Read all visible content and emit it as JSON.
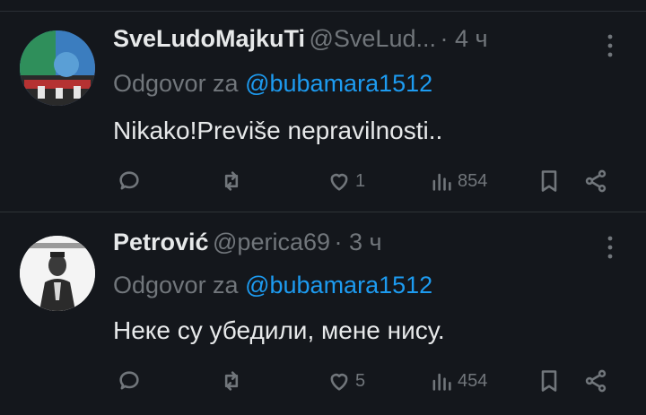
{
  "tweets": [
    {
      "name": "SveLudoMajkuTi",
      "handle": "@SveLud...",
      "time": "· 4 ч",
      "reply_prefix": "Odgovor za",
      "reply_to": "@bubamara1512",
      "text": "Nikako!Previše nepravilnosti..",
      "likes": "1",
      "views": "854"
    },
    {
      "name": "Petrović",
      "handle": "@perica69",
      "time": "· 3 ч",
      "reply_prefix": "Odgovor za",
      "reply_to": "@bubamara1512",
      "text": "Неке су убедили, мене нису.",
      "likes": "5",
      "views": "454"
    }
  ],
  "icons": {
    "more": "more-vertical-icon",
    "reply": "reply-icon",
    "retweet": "retweet-icon",
    "like": "heart-icon",
    "views": "views-chart-icon",
    "bookmark": "bookmark-icon",
    "share": "share-icon"
  },
  "colors": {
    "background": "#14171c",
    "text": "#e7e9ea",
    "muted": "#71767b",
    "link": "#1d9bf0"
  }
}
